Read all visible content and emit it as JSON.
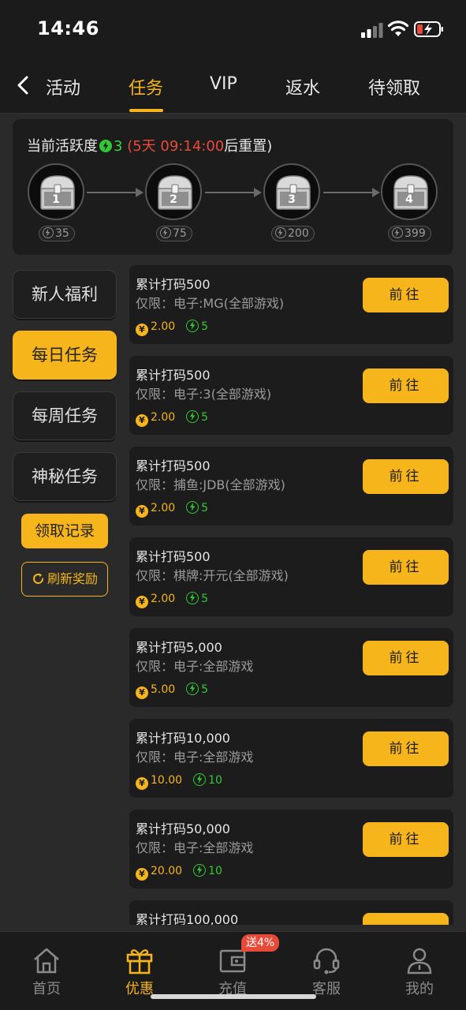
{
  "status_bar": {
    "time": "14:46"
  },
  "header": {
    "tabs": [
      {
        "label": "活动"
      },
      {
        "label": "任务"
      },
      {
        "label": "VIP"
      },
      {
        "label": "返水"
      },
      {
        "label": "待领取"
      }
    ],
    "active_tab": "任务"
  },
  "activity": {
    "label": "当前活跃度",
    "points": "3",
    "reset_prefix": "(",
    "reset_time": "5天 09:14:00",
    "reset_suffix": "后重置)",
    "chests": [
      {
        "number": "1",
        "required": "35"
      },
      {
        "number": "2",
        "required": "75"
      },
      {
        "number": "3",
        "required": "200"
      },
      {
        "number": "4",
        "required": "399"
      }
    ]
  },
  "sidebar": {
    "items": [
      {
        "label": "新人福利"
      },
      {
        "label": "每日任务"
      },
      {
        "label": "每周任务"
      },
      {
        "label": "神秘任务"
      }
    ],
    "active_item": "每日任务",
    "record_label": "领取记录",
    "refresh_label": "刷新奖励"
  },
  "tasks": [
    {
      "title": "累计打码500",
      "scope": "仅限：电子:MG(全部游戏)",
      "reward": "2.00",
      "points": "5",
      "button": "前往"
    },
    {
      "title": "累计打码500",
      "scope": "仅限：电子:3(全部游戏)",
      "reward": "2.00",
      "points": "5",
      "button": "前往"
    },
    {
      "title": "累计打码500",
      "scope": "仅限：捕鱼:JDB(全部游戏)",
      "reward": "2.00",
      "points": "5",
      "button": "前往"
    },
    {
      "title": "累计打码500",
      "scope": "仅限：棋牌:开元(全部游戏)",
      "reward": "2.00",
      "points": "5",
      "button": "前往"
    },
    {
      "title": "累计打码5,000",
      "scope": "仅限：电子:全部游戏",
      "reward": "5.00",
      "points": "5",
      "button": "前往"
    },
    {
      "title": "累计打码10,000",
      "scope": "仅限：电子:全部游戏",
      "reward": "10.00",
      "points": "10",
      "button": "前往"
    },
    {
      "title": "累计打码50,000",
      "scope": "仅限：电子:全部游戏",
      "reward": "20.00",
      "points": "10",
      "button": "前往"
    },
    {
      "title": "累计打码100,000",
      "scope": "",
      "reward": "",
      "points": "",
      "button": ""
    }
  ],
  "bottom_nav": {
    "items": [
      {
        "label": "首页",
        "icon": "home-icon"
      },
      {
        "label": "优惠",
        "icon": "gift-icon"
      },
      {
        "label": "充值",
        "icon": "wallet-icon"
      },
      {
        "label": "客服",
        "icon": "headset-icon"
      },
      {
        "label": "我的",
        "icon": "user-icon"
      }
    ],
    "active_item": "优惠",
    "deposit_badge": "送4%"
  },
  "colors": {
    "accent": "#f5b51b",
    "green": "#34c934",
    "red": "#e84a3a",
    "background": "#2a2a2a",
    "card": "#1c1c1c"
  }
}
